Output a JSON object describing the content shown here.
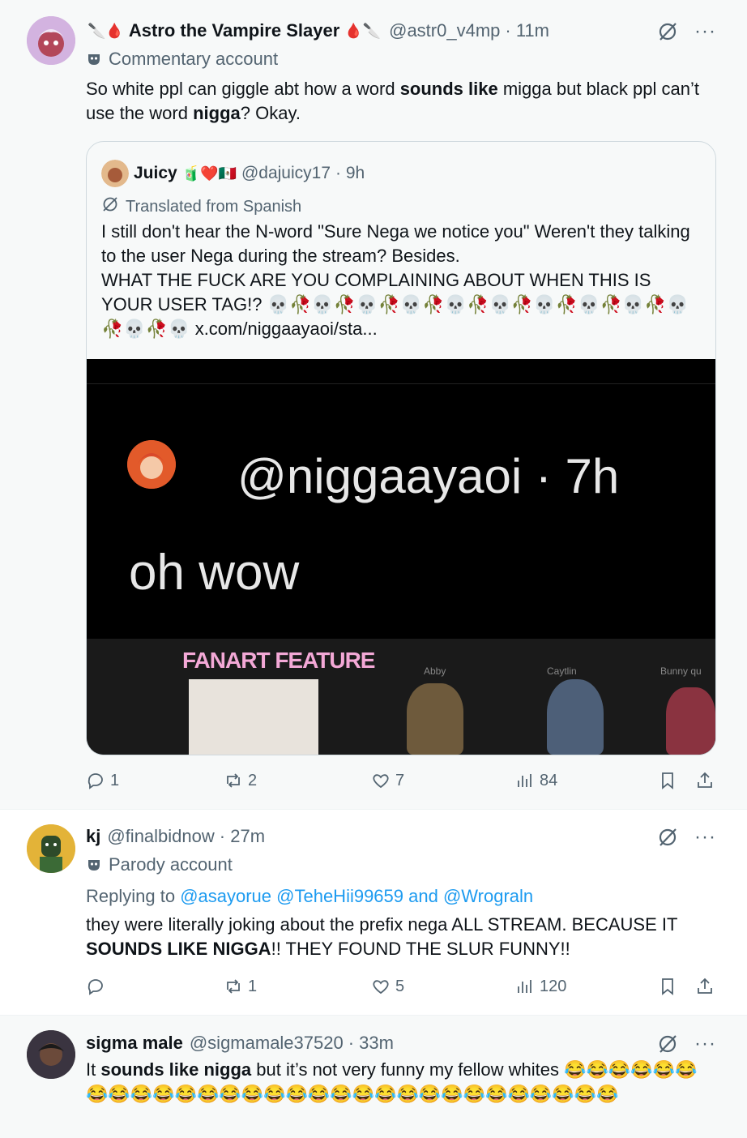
{
  "tweet1": {
    "name": "Astro the Vampire Slayer",
    "name_emoji_left": "🔪🩸",
    "name_emoji_right": "🩸🔪",
    "handle": "@astr0_v4mp",
    "time": "· 11m",
    "label": "Commentary account",
    "text_parts": [
      "So white ppl can giggle abt how a word ",
      "sounds like",
      " migga but black ppl can’t use the word ",
      "nigga",
      "? Okay."
    ],
    "quote": {
      "name": "Juicy",
      "emoji": "🧃❤️🇲🇽",
      "handle": "@dajuicy17",
      "time": "· 9h",
      "translated": "Translated from Spanish",
      "line1": "I still don't hear the N-word \"Sure Nega we notice you\" Weren't they talking to the user Nega during the stream? Besides.",
      "line2": "WHAT THE FUCK ARE YOU COMPLAINING ABOUT WHEN THIS IS YOUR USER TAG!? 💀🥀💀🥀💀🥀💀🥀💀🥀💀🥀💀🥀💀🥀💀🥀💀🥀💀🥀💀 ",
      "link": "x.com/niggaayaoi/sta...",
      "media_handle": "@niggaayaoi · 7h",
      "media_text": "oh wow",
      "media_banner": "FANART FEATURE",
      "media_label_abby": "Abby",
      "media_label_caytlin": "Caytlin",
      "media_label_bunny": "Bunny qu"
    },
    "replies": "1",
    "reposts": "2",
    "likes": "7",
    "views": "84"
  },
  "tweet2": {
    "name": "kj",
    "handle": "@finalbidnow",
    "time": "· 27m",
    "label": "Parody account",
    "replying_prefix": "Replying to ",
    "replying_targets": "@asayorue @TeheHii99659 and @Wrograln",
    "text_parts": [
      "they were literally joking about the prefix nega ALL STREAM. BECAUSE IT ",
      "SOUNDS LIKE NIGGA",
      "!! THEY FOUND THE SLUR FUNNY!!"
    ],
    "replies": "",
    "reposts": "1",
    "likes": "5",
    "views": "120"
  },
  "tweet3": {
    "name": "sigma male",
    "handle": "@sigmamale37520",
    "time": "· 33m",
    "text_parts": [
      "It ",
      "sounds like nigga",
      " but it’s not very funny my fellow whites 😂😂😂😂😂😂😂😂😂😂😂😂😂😂😂😂😂😂😂😂😂😂😂😂😂😂😂😂😂😂"
    ]
  },
  "colors": {
    "accent": "#1d9bf0",
    "muted": "#536471",
    "border": "#cfd9de"
  }
}
